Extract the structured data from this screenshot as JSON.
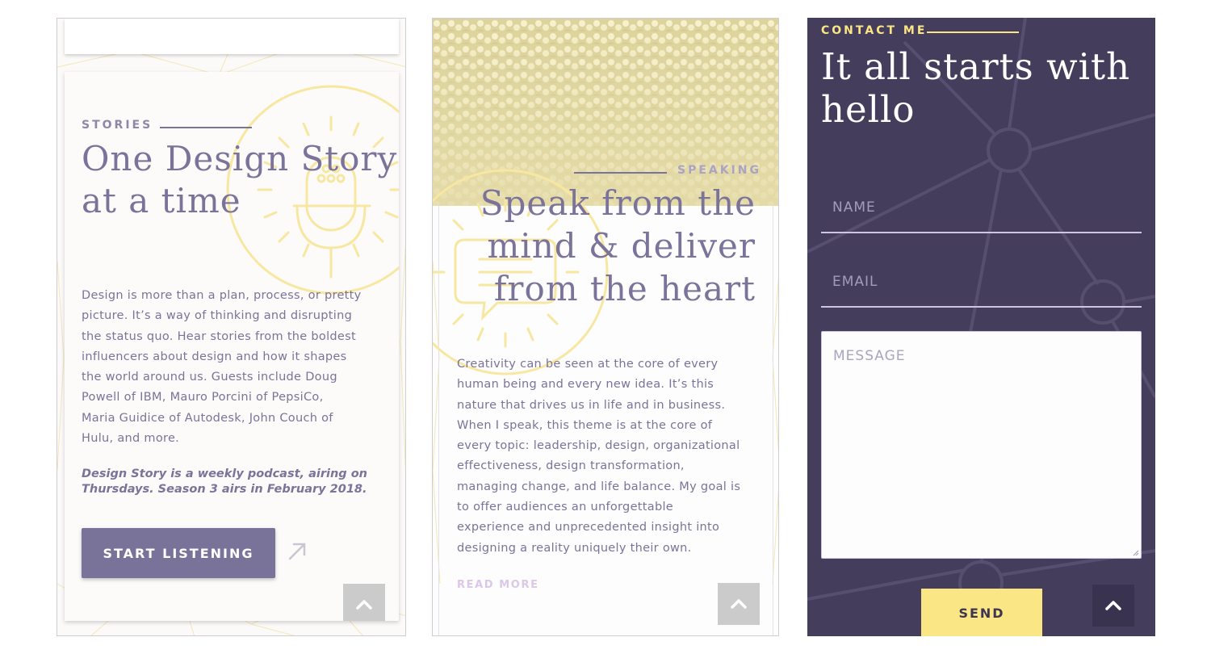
{
  "colors": {
    "purple": "#7b7399",
    "dark_purple": "#453d5c",
    "yellow": "#fbe685",
    "light_yellow": "#f7e7a0",
    "lavender": "#cfc4e4",
    "white": "#ffffff"
  },
  "stories": {
    "eyebrow": "STORIES",
    "title_line1": "One Design Story",
    "title_line2": "at a time",
    "body": [
      "Design is more than a plan, process, or pretty",
      "picture. It’s a way of thinking and disrupting",
      "the status quo. Hear stories from the boldest",
      "influencers about design and how it shapes",
      "the world around us. Guests include Doug",
      "Powell of IBM, Mauro Porcini of PepsiCo,",
      "Maria Guidice of Autodesk, John Couch of",
      "Hulu, and more."
    ],
    "note_line1": "Design Story is a weekly podcast, airing on",
    "note_line2": "Thursdays. Season 3 airs in February 2018.",
    "button_label": "START LISTENING",
    "icons": [
      "microphone-icon",
      "arrow-up-right-icon",
      "chevron-up-icon"
    ]
  },
  "speaking": {
    "eyebrow": "SPEAKING",
    "title_line1": "Speak from the",
    "title_line2": "mind & deliver",
    "title_line3": "from the heart",
    "body": [
      "Creativity can be seen at the core of every",
      "human being and every new idea. It’s this",
      "nature that drives us in life and in business.",
      "When I speak, this theme is at the core of",
      "every topic: leadership, design, organizational",
      "effectiveness, design transformation,",
      "managing change, and life balance. My goal is",
      "to offer audiences an unforgettable",
      "experience and unprecedented insight into",
      "designing a reality uniquely their own."
    ],
    "link_label": "READ MORE",
    "icons": [
      "speech-bubble-icon",
      "chevron-up-icon"
    ]
  },
  "contact": {
    "eyebrow": "CONTACT ME",
    "title_line1": "It all starts with",
    "title_line2": "hello",
    "name_placeholder": "NAME",
    "email_placeholder": "EMAIL",
    "message_placeholder": "MESSAGE",
    "send_label": "SEND",
    "icons": [
      "chevron-up-icon"
    ]
  }
}
